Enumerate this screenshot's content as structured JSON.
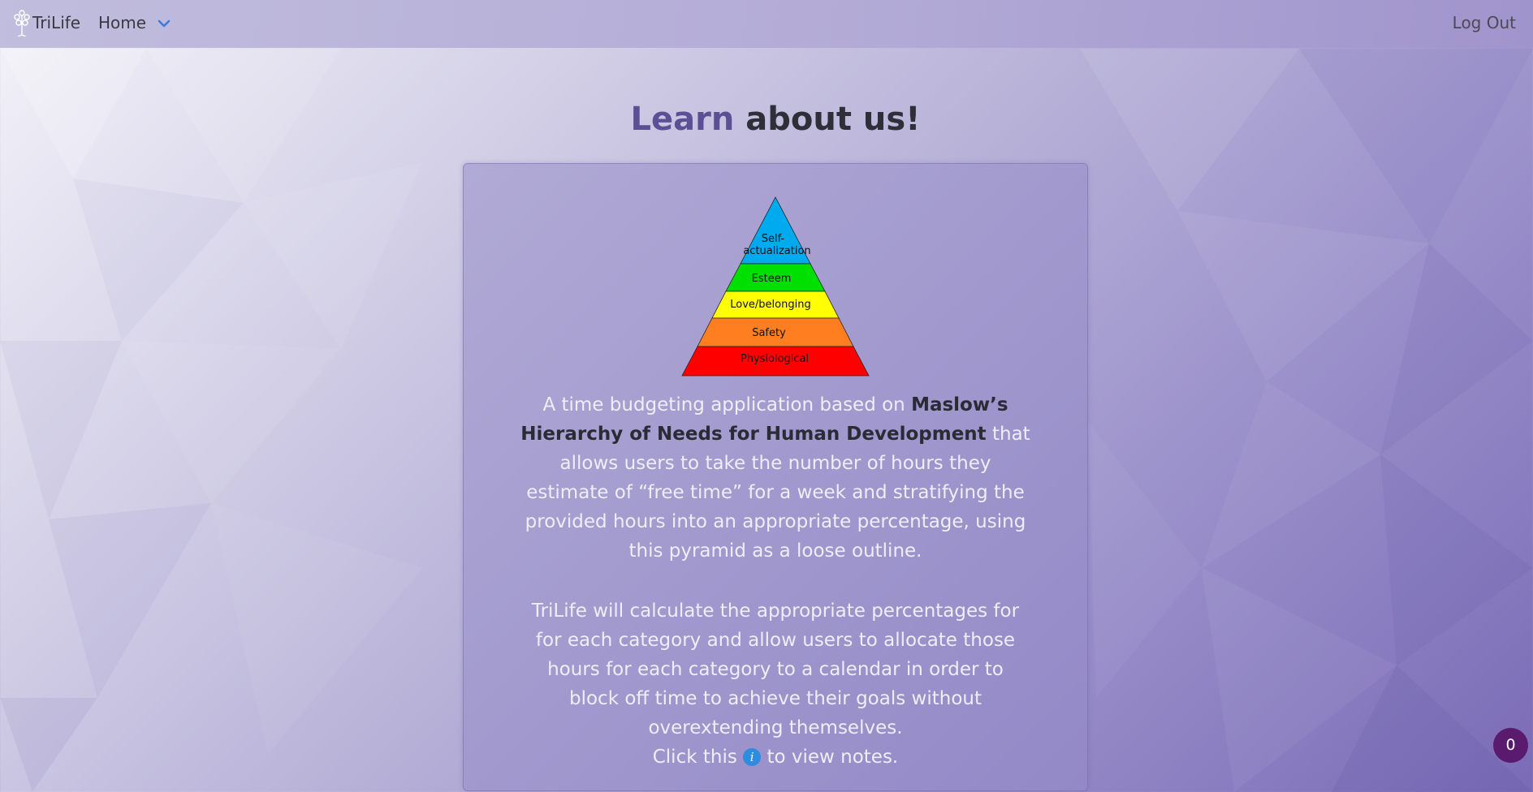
{
  "navbar": {
    "brand": "TriLife",
    "home_label": "Home",
    "logout_label": "Log Out"
  },
  "heading": {
    "accent": "Learn",
    "rest": " about us!"
  },
  "pyramid": {
    "levels": [
      {
        "line1": "Self-",
        "line2": "actualization",
        "color": "#00aaee"
      },
      {
        "line1": "Esteem",
        "color": "#00e000"
      },
      {
        "line1": "Love/belonging",
        "color": "#ffff00"
      },
      {
        "line1": "Safety",
        "color": "#ff7f20"
      },
      {
        "line1": "Physiological",
        "color": "#ff0000"
      }
    ]
  },
  "description": {
    "intro": "A time budgeting application based on ",
    "bold": "Maslow’s Hierarchy of Needs for Human Development",
    "rest": " that allows users to take the number of hours they estimate of “free time” for a week and stratifying the provided hours into an appropriate percentage, using this pyramid as a loose outline.",
    "second": "TriLife will calculate the appropriate percentages for for each category and allow users to allocate those hours for each category to a calendar in order to block off time to achieve their goals without overextending themselves.",
    "notes_before": "Click this ",
    "notes_icon": "info-icon",
    "notes_after": " to view notes."
  },
  "badge": {
    "count": "0"
  },
  "colors": {
    "accent": "#5b4f96",
    "badge": "#5a1a6e",
    "info": "#2d8be0"
  }
}
